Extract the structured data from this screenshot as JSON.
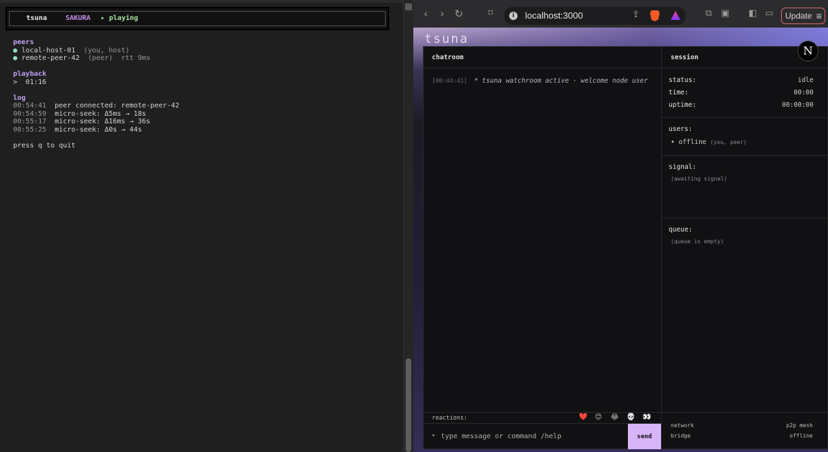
{
  "terminal": {
    "header": {
      "app": "tsuna",
      "room": "SAKURA",
      "state": "▸ playing"
    },
    "peers": {
      "title": "peers",
      "items": [
        {
          "bullet": "●",
          "name": "local-host-01",
          "note": "(you, host)",
          "extra": ""
        },
        {
          "bullet": "●",
          "name": "remote-peer-42",
          "note": "(peer)",
          "extra": "rtt 9ms"
        }
      ]
    },
    "playback": {
      "title": "playback",
      "line": ">  01:16"
    },
    "log": {
      "title": "log",
      "items": [
        {
          "time": "00:54:41",
          "msg": "peer connected: remote-peer-42"
        },
        {
          "time": "00:54:59",
          "msg": "micro-seek: Δ5ms → 18s"
        },
        {
          "time": "00:55:17",
          "msg": "micro-seek: Δ16ms → 36s"
        },
        {
          "time": "00:55:25",
          "msg": "micro-seek: Δ0s → 44s"
        }
      ]
    },
    "footer": "press q to quit"
  },
  "browser": {
    "url": "localhost:3000",
    "update_label": "Update",
    "icons": {
      "back": "back-icon",
      "forward": "forward-icon",
      "reload": "reload-icon",
      "bookmark": "bookmark-icon"
    }
  },
  "app": {
    "title": "tsuna",
    "chat": {
      "heading": "chatroom",
      "messages": [
        {
          "time": "[00:44:41]",
          "text": "* tsuna watchroom active · welcome node user"
        }
      ],
      "reactions_label": "reactions:",
      "reactions": [
        "❤️",
        "😊",
        "😂",
        "💀",
        "👀"
      ],
      "prompt": "▸",
      "placeholder": "type message or command /help",
      "send_label": "send"
    },
    "session": {
      "heading": "session",
      "status_label": "status:",
      "status_value": "idle",
      "time_label": "time:",
      "time_value": "00:00",
      "uptime_label": "uptime:",
      "uptime_value": "00:00:00",
      "users_label": "users:",
      "users": [
        {
          "bullet": "•",
          "name": "offline",
          "tag": "(you, peer)"
        }
      ],
      "signal_label": "signal:",
      "signal_hint": "(awaiting signal)",
      "queue_label": "queue:",
      "queue_hint": "(queue is empty)",
      "network_label": "network",
      "network_value": "p2p mesh",
      "bridge_label": "bridge",
      "bridge_value": "offline",
      "logo_letter": "N"
    }
  }
}
